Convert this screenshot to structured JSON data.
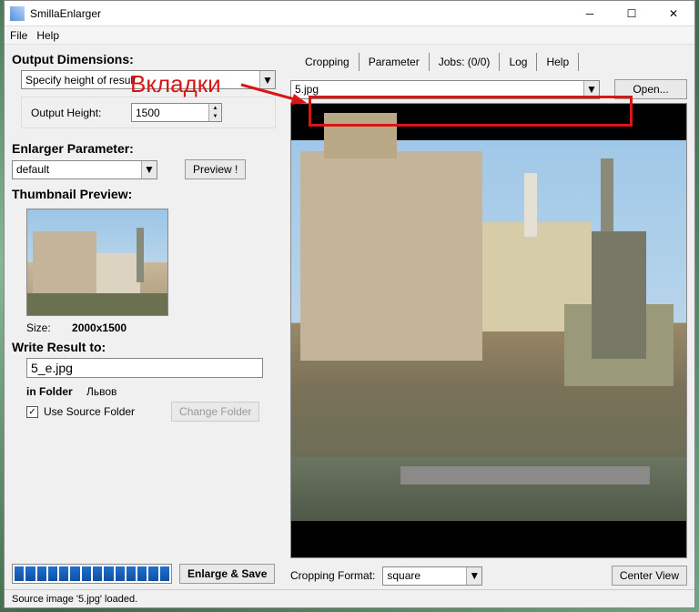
{
  "window": {
    "title": "SmillaEnlarger"
  },
  "menu": {
    "file": "File",
    "help": "Help"
  },
  "annotation": {
    "label": "Вкладки"
  },
  "left": {
    "output_dimensions_title": "Output Dimensions:",
    "dim_mode": "Specify height of result",
    "output_height_label": "Output Height:",
    "output_height_value": "1500",
    "enlarger_param_title": "Enlarger Parameter:",
    "param_preset": "default",
    "preview_btn": "Preview !",
    "thumb_title": "Thumbnail Preview:",
    "size_label": "Size:",
    "size_value": "2000x1500",
    "write_title": "Write Result to:",
    "outfile": "5_e.jpg",
    "in_folder_label": "in Folder",
    "folder_name": "Львов",
    "use_source_folder": "Use Source Folder",
    "change_folder_btn": "Change Folder",
    "enlarge_btn": "Enlarge & Save"
  },
  "right": {
    "tabs": {
      "cropping": "Cropping",
      "parameter": "Parameter",
      "jobs": "Jobs: (0/0)",
      "log": "Log",
      "help": "Help"
    },
    "file_dropdown": "5.jpg",
    "open_btn": "Open...",
    "crop_format_label": "Cropping Format:",
    "crop_format_value": "square",
    "center_view_btn": "Center View"
  },
  "status": "Source image '5.jpg' loaded."
}
